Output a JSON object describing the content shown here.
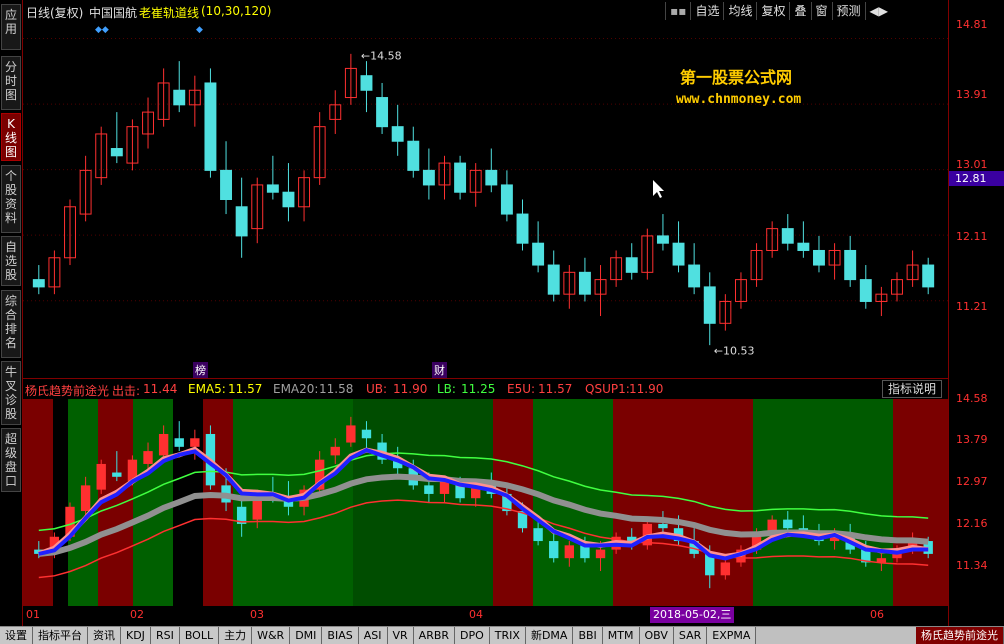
{
  "sidebar": [
    {
      "label": "应用",
      "active": false
    },
    {
      "label": "分时图",
      "active": false
    },
    {
      "label": "K线图",
      "active": true
    },
    {
      "label": "个股资料",
      "active": false
    },
    {
      "label": "自选股",
      "active": false
    },
    {
      "label": "综合排名",
      "active": false
    },
    {
      "label": "牛叉诊股",
      "active": false
    },
    {
      "label": "超级盘口",
      "active": false
    }
  ],
  "top": {
    "period": "日线(复权)",
    "stock": "中国国航",
    "indicator": "老崔轨道线",
    "params": "(10,30,120)",
    "buttons": [
      "自选",
      "均线",
      "复权",
      "叠",
      "窗",
      "预测"
    ],
    "icon_menu": "menu-icon",
    "icon_arrows": "arrows-icon"
  },
  "watermark": {
    "line1": "第一股票公式网",
    "line2": "www.chnmoney.com"
  },
  "price_axis": [
    "14.81",
    "13.91",
    "13.01",
    "12.11",
    "11.21"
  ],
  "current_price": "12.81",
  "price_marks": {
    "high": "14.58",
    "low": "10.53"
  },
  "event_marks": [
    "榜",
    "财"
  ],
  "indicator_bar": {
    "name": "杨氏趋势前途光",
    "items": [
      {
        "label": "出击:",
        "value": "11.44",
        "color": "#ff4040"
      },
      {
        "label": "EMA5:",
        "value": "11.57",
        "color": "#ffff00"
      },
      {
        "label": "EMA20:",
        "value": "11.58",
        "color": "#a0a0a0"
      },
      {
        "label": "UB:",
        "value": "11.90",
        "color": "#ff4040"
      },
      {
        "label": "LB:",
        "value": "11.25",
        "color": "#40ff40"
      },
      {
        "label": "E5U:",
        "value": "11.57",
        "color": "#ff4040"
      },
      {
        "label": "QSUP1:",
        "value": "11.90",
        "color": "#ff4040"
      }
    ],
    "help_button": "指标说明"
  },
  "indicator_axis": [
    "14.58",
    "13.79",
    "12.97",
    "12.16",
    "11.34"
  ],
  "date_axis": [
    "01",
    "02",
    "03",
    "04",
    "06"
  ],
  "date_highlight": "2018-05-02,三",
  "bottom_tabs": [
    "设置",
    "指标平台",
    "资讯",
    "KDJ",
    "RSI",
    "BOLL",
    "主力",
    "W&R",
    "DMI",
    "BIAS",
    "ASI",
    "VR",
    "ARBR",
    "DPO",
    "TRIX",
    "新DMA",
    "BBI",
    "MTM",
    "OBV",
    "SAR",
    "EXPMA",
    "杨氏趋势前途光"
  ],
  "colors": {
    "up": "#ff3030",
    "down": "#50e0e0",
    "axis": "#800000",
    "accent": "#ffcc00"
  },
  "chart_data": {
    "type": "candlestick",
    "ylim": [
      10.3,
      14.9
    ],
    "candles": [
      [
        11.5,
        11.7,
        11.3,
        11.4
      ],
      [
        11.4,
        11.9,
        11.3,
        11.8
      ],
      [
        11.8,
        12.6,
        11.7,
        12.5
      ],
      [
        12.4,
        13.2,
        12.3,
        13.0
      ],
      [
        12.9,
        13.6,
        12.8,
        13.5
      ],
      [
        13.3,
        13.8,
        13.1,
        13.2
      ],
      [
        13.1,
        13.7,
        13.0,
        13.6
      ],
      [
        13.5,
        14.0,
        13.3,
        13.8
      ],
      [
        13.7,
        14.4,
        13.6,
        14.2
      ],
      [
        14.1,
        14.5,
        13.8,
        13.9
      ],
      [
        13.9,
        14.3,
        13.6,
        14.1
      ],
      [
        14.2,
        14.4,
        12.9,
        13.0
      ],
      [
        13.0,
        13.4,
        12.4,
        12.6
      ],
      [
        12.5,
        12.9,
        11.8,
        12.1
      ],
      [
        12.2,
        12.9,
        12.0,
        12.8
      ],
      [
        12.8,
        13.2,
        12.6,
        12.7
      ],
      [
        12.7,
        13.1,
        12.3,
        12.5
      ],
      [
        12.5,
        13.0,
        12.3,
        12.9
      ],
      [
        12.9,
        13.8,
        12.8,
        13.6
      ],
      [
        13.7,
        14.1,
        13.5,
        13.9
      ],
      [
        14.0,
        14.6,
        13.9,
        14.4
      ],
      [
        14.3,
        14.5,
        13.8,
        14.1
      ],
      [
        14.0,
        14.2,
        13.5,
        13.6
      ],
      [
        13.6,
        13.9,
        13.2,
        13.4
      ],
      [
        13.4,
        13.6,
        12.9,
        13.0
      ],
      [
        13.0,
        13.3,
        12.6,
        12.8
      ],
      [
        12.8,
        13.2,
        12.6,
        13.1
      ],
      [
        13.1,
        13.2,
        12.6,
        12.7
      ],
      [
        12.7,
        13.1,
        12.5,
        13.0
      ],
      [
        13.0,
        13.3,
        12.7,
        12.8
      ],
      [
        12.8,
        13.0,
        12.3,
        12.4
      ],
      [
        12.4,
        12.6,
        11.9,
        12.0
      ],
      [
        12.0,
        12.3,
        11.6,
        11.7
      ],
      [
        11.7,
        11.9,
        11.2,
        11.3
      ],
      [
        11.3,
        11.7,
        11.1,
        11.6
      ],
      [
        11.6,
        11.8,
        11.2,
        11.3
      ],
      [
        11.3,
        11.7,
        11.0,
        11.5
      ],
      [
        11.5,
        11.9,
        11.4,
        11.8
      ],
      [
        11.8,
        12.0,
        11.5,
        11.6
      ],
      [
        11.6,
        12.2,
        11.5,
        12.1
      ],
      [
        12.1,
        12.4,
        11.9,
        12.0
      ],
      [
        12.0,
        12.3,
        11.6,
        11.7
      ],
      [
        11.7,
        12.0,
        11.3,
        11.4
      ],
      [
        11.4,
        11.6,
        10.6,
        10.9
      ],
      [
        10.9,
        11.3,
        10.8,
        11.2
      ],
      [
        11.2,
        11.6,
        11.1,
        11.5
      ],
      [
        11.5,
        12.0,
        11.4,
        11.9
      ],
      [
        11.9,
        12.3,
        11.8,
        12.2
      ],
      [
        12.2,
        12.4,
        11.9,
        12.0
      ],
      [
        12.0,
        12.3,
        11.8,
        11.9
      ],
      [
        11.9,
        12.1,
        11.6,
        11.7
      ],
      [
        11.7,
        12.0,
        11.5,
        11.9
      ],
      [
        11.9,
        12.1,
        11.4,
        11.5
      ],
      [
        11.5,
        11.7,
        11.1,
        11.2
      ],
      [
        11.2,
        11.4,
        11.0,
        11.3
      ],
      [
        11.3,
        11.6,
        11.2,
        11.5
      ],
      [
        11.5,
        11.9,
        11.4,
        11.7
      ],
      [
        11.7,
        11.8,
        11.3,
        11.4
      ]
    ]
  }
}
